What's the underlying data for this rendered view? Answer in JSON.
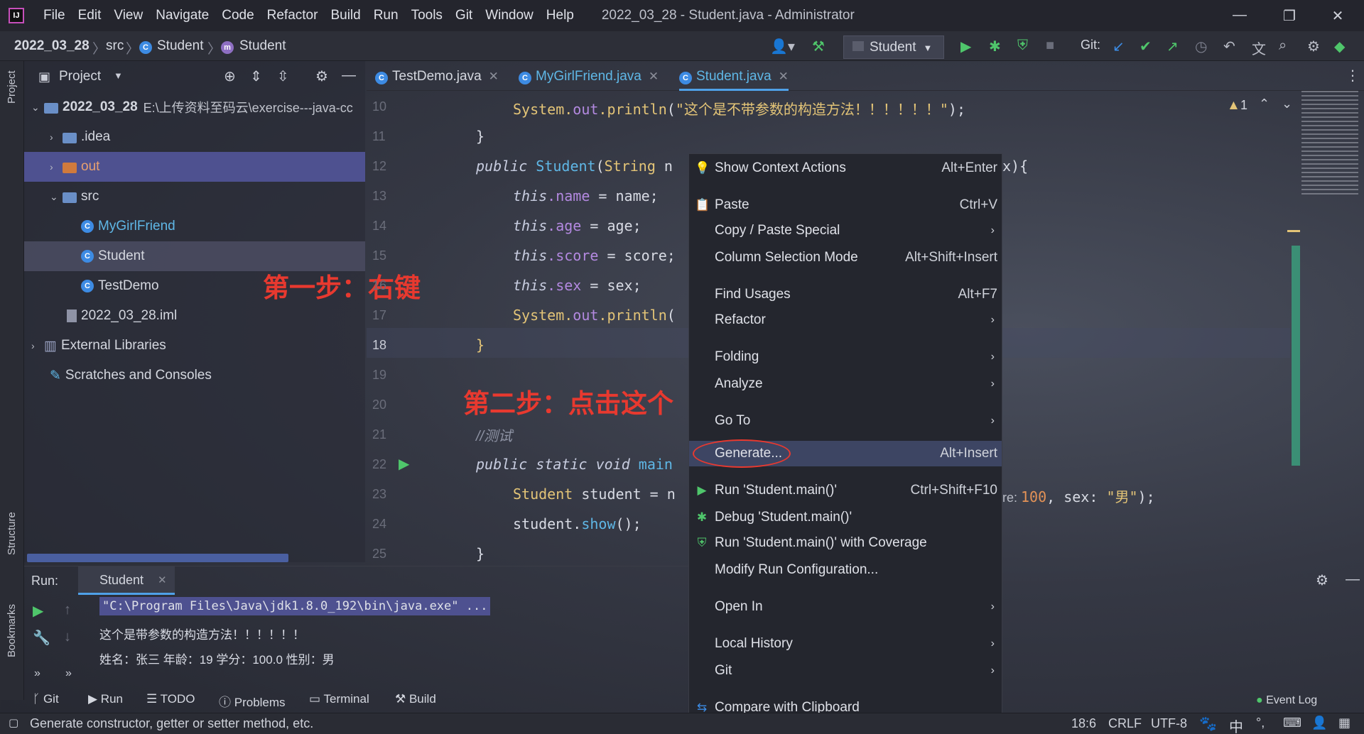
{
  "window": {
    "title": "2022_03_28 - Student.java - Administrator",
    "menus": [
      "File",
      "Edit",
      "View",
      "Navigate",
      "Code",
      "Refactor",
      "Build",
      "Run",
      "Tools",
      "Git",
      "Window",
      "Help"
    ],
    "logo": "IJ"
  },
  "navbar": {
    "crumbs": [
      "2022_03_28",
      "src",
      "Student",
      "Student"
    ],
    "run_config": "Student",
    "git_label": "Git:"
  },
  "left_strip": {
    "project": "Project",
    "structure": "Structure",
    "bookmarks": "Bookmarks"
  },
  "project": {
    "header": "Project",
    "tree": [
      {
        "label": "2022_03_28",
        "path": "E:\\上传资料至码云\\exercise---java-cc"
      },
      {
        "label": ".idea"
      },
      {
        "label": "out"
      },
      {
        "label": "src"
      },
      {
        "label": "MyGirlFriend"
      },
      {
        "label": "Student"
      },
      {
        "label": "TestDemo"
      },
      {
        "label": "2022_03_28.iml"
      },
      {
        "label": "External Libraries"
      },
      {
        "label": "Scratches and Consoles"
      }
    ]
  },
  "annotations": {
    "step1": "第一步：右键",
    "step2": "第二步：点击这个"
  },
  "editor": {
    "tabs": [
      "TestDemo.java",
      "MyGirlFriend.java",
      "Student.java"
    ],
    "line_numbers": [
      "10",
      "11",
      "12",
      "13",
      "14",
      "15",
      "16",
      "17",
      "18",
      "19",
      "20",
      "21",
      "22",
      "23",
      "24",
      "25"
    ],
    "warning_count": "1",
    "code": {
      "l10_a": "System.",
      "l10_b": "out",
      "l10_c": ".",
      "l10_d": "println",
      "l10_e": "(",
      "l10_f": "\"这个是不带参数的构造方法！！！！！！\"",
      "l10_g": ");",
      "l11": "}",
      "l12_a": "public ",
      "l12_b": "Student",
      "l12_c": "(",
      "l12_d": "String",
      "l12_e": " n",
      "l12_tail": "x){",
      "l13_a": "this",
      "l13_b": ".name",
      "l13_c": " = name;",
      "l14_a": "this",
      "l14_b": ".age",
      "l14_c": " = age;",
      "l15_a": "this",
      "l15_b": ".score",
      "l15_c": " = score;",
      "l16_a": "this",
      "l16_b": ".sex",
      "l16_c": " = sex;",
      "l17_a": "System.",
      "l17_b": "out",
      "l17_c": ".",
      "l17_d": "println",
      "l17_e": "(",
      "l18": "}",
      "l21": "//测试",
      "l22_a": "public static void ",
      "l22_b": "main",
      "l23_a": "Student",
      "l23_b": " student = n",
      "l23_tail_a": "re: ",
      "l23_tail_b": "100",
      "l23_tail_c": ", sex: ",
      "l23_tail_d": "\"男\"",
      "l23_tail_e": ");",
      "l24_a": "student.",
      "l24_b": "show",
      "l24_c": "();",
      "l25": "}"
    }
  },
  "context_menu": {
    "items": [
      {
        "label": "Show Context Actions",
        "shortcut": "Alt+Enter"
      },
      {
        "label": "Paste",
        "shortcut": "Ctrl+V"
      },
      {
        "label": "Copy / Paste Special",
        "shortcut": ""
      },
      {
        "label": "Column Selection Mode",
        "shortcut": "Alt+Shift+Insert"
      },
      {
        "label": "Find Usages",
        "shortcut": "Alt+F7"
      },
      {
        "label": "Refactor",
        "shortcut": ""
      },
      {
        "label": "Folding",
        "shortcut": ""
      },
      {
        "label": "Analyze",
        "shortcut": ""
      },
      {
        "label": "Go To",
        "shortcut": ""
      },
      {
        "label": "Generate...",
        "shortcut": "Alt+Insert"
      },
      {
        "label": "Run 'Student.main()'",
        "shortcut": "Ctrl+Shift+F10"
      },
      {
        "label": "Debug 'Student.main()'",
        "shortcut": ""
      },
      {
        "label": "Run 'Student.main()' with Coverage",
        "shortcut": ""
      },
      {
        "label": "Modify Run Configuration...",
        "shortcut": ""
      },
      {
        "label": "Open In",
        "shortcut": ""
      },
      {
        "label": "Local History",
        "shortcut": ""
      },
      {
        "label": "Git",
        "shortcut": ""
      },
      {
        "label": "Compare with Clipboard",
        "shortcut": ""
      }
    ]
  },
  "run": {
    "label": "Run:",
    "tab": "Student",
    "output": [
      "\"C:\\Program Files\\Java\\jdk1.8.0_192\\bin\\java.exe\" ...",
      "这个是带参数的构造方法！！！！！！",
      "姓名：张三 年龄：19 学分：100.0 性别：男"
    ]
  },
  "bottom_tabs": [
    "Git",
    "Run",
    "TODO",
    "Problems",
    "Terminal",
    "Build"
  ],
  "event_log": "Event Log",
  "status": {
    "message": "Generate constructor, getter or setter method, etc.",
    "position": "18:6",
    "line_sep": "CRLF",
    "encoding": "UTF-8",
    "ime": "中"
  }
}
